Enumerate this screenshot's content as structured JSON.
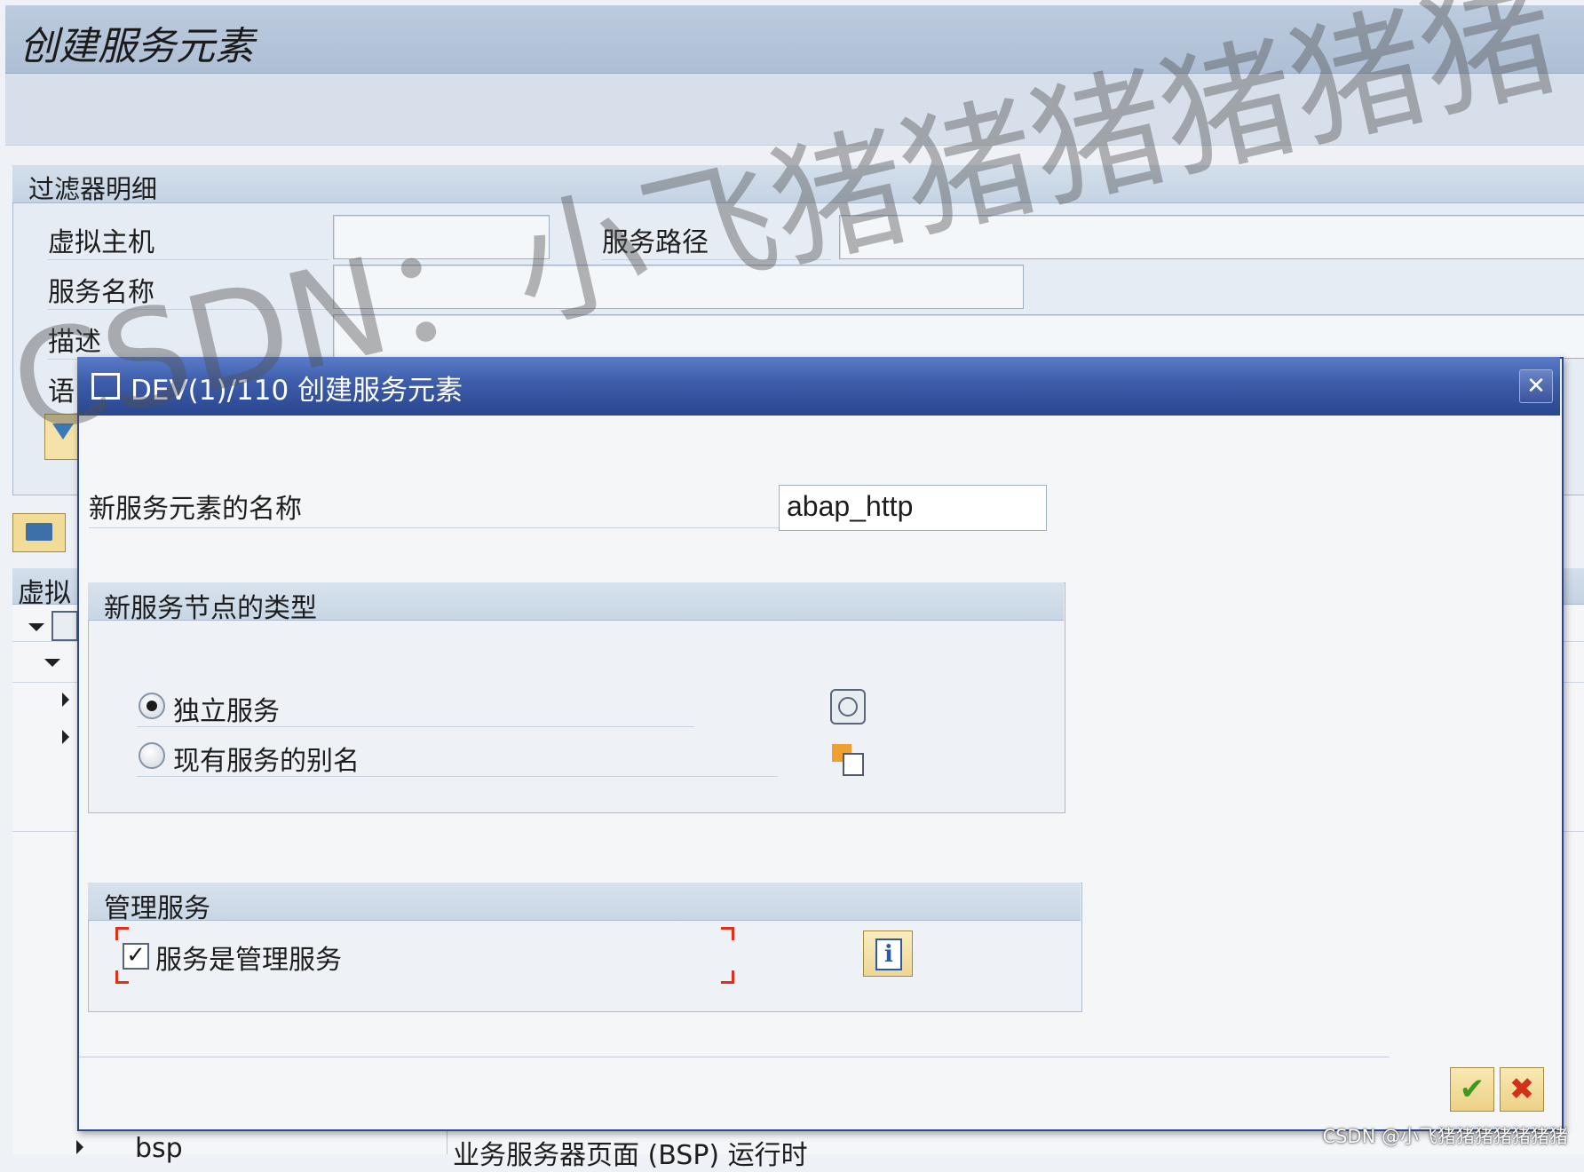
{
  "window": {
    "title": "创建服务元素"
  },
  "filter": {
    "header": "过滤器明细",
    "virtual_host_label": "虚拟主机",
    "virtual_host_value": "",
    "service_path_label": "服务路径",
    "service_path_value": "",
    "service_name_label": "服务名称",
    "service_name_value": "",
    "description_label": "描述",
    "description_value": "",
    "language_label": "语"
  },
  "tree": {
    "header_label": "虚拟",
    "bottom_row_name": "bsp",
    "bottom_row_desc": "业务服务器页面 (BSP) 运行时"
  },
  "dialog": {
    "title": "DEV(1)/110 创建服务元素",
    "close_symbol": "✕",
    "name_label": "新服务元素的名称",
    "name_value": "abap_http",
    "node_type_group": {
      "header": "新服务节点的类型",
      "option_independent": "独立服务",
      "option_alias": "现有服务的别名",
      "selected": "独立服务"
    },
    "admin_group": {
      "header": "管理服务",
      "checkbox_label": "服务是管理服务",
      "checked": true
    },
    "info_symbol": "i",
    "ok_symbol": "✔",
    "cancel_symbol": "✖"
  },
  "watermark": "CSDN：小飞猪猪猪猪猪猪",
  "credit": "CSDN @小飞猪猪猪猪猪猪猪",
  "colors": {
    "dialog_title_bg": "#3c5ca9",
    "group_header_bg": "#c8d6e5",
    "ok_green": "#3d9a1d",
    "cancel_red": "#d0321b"
  }
}
